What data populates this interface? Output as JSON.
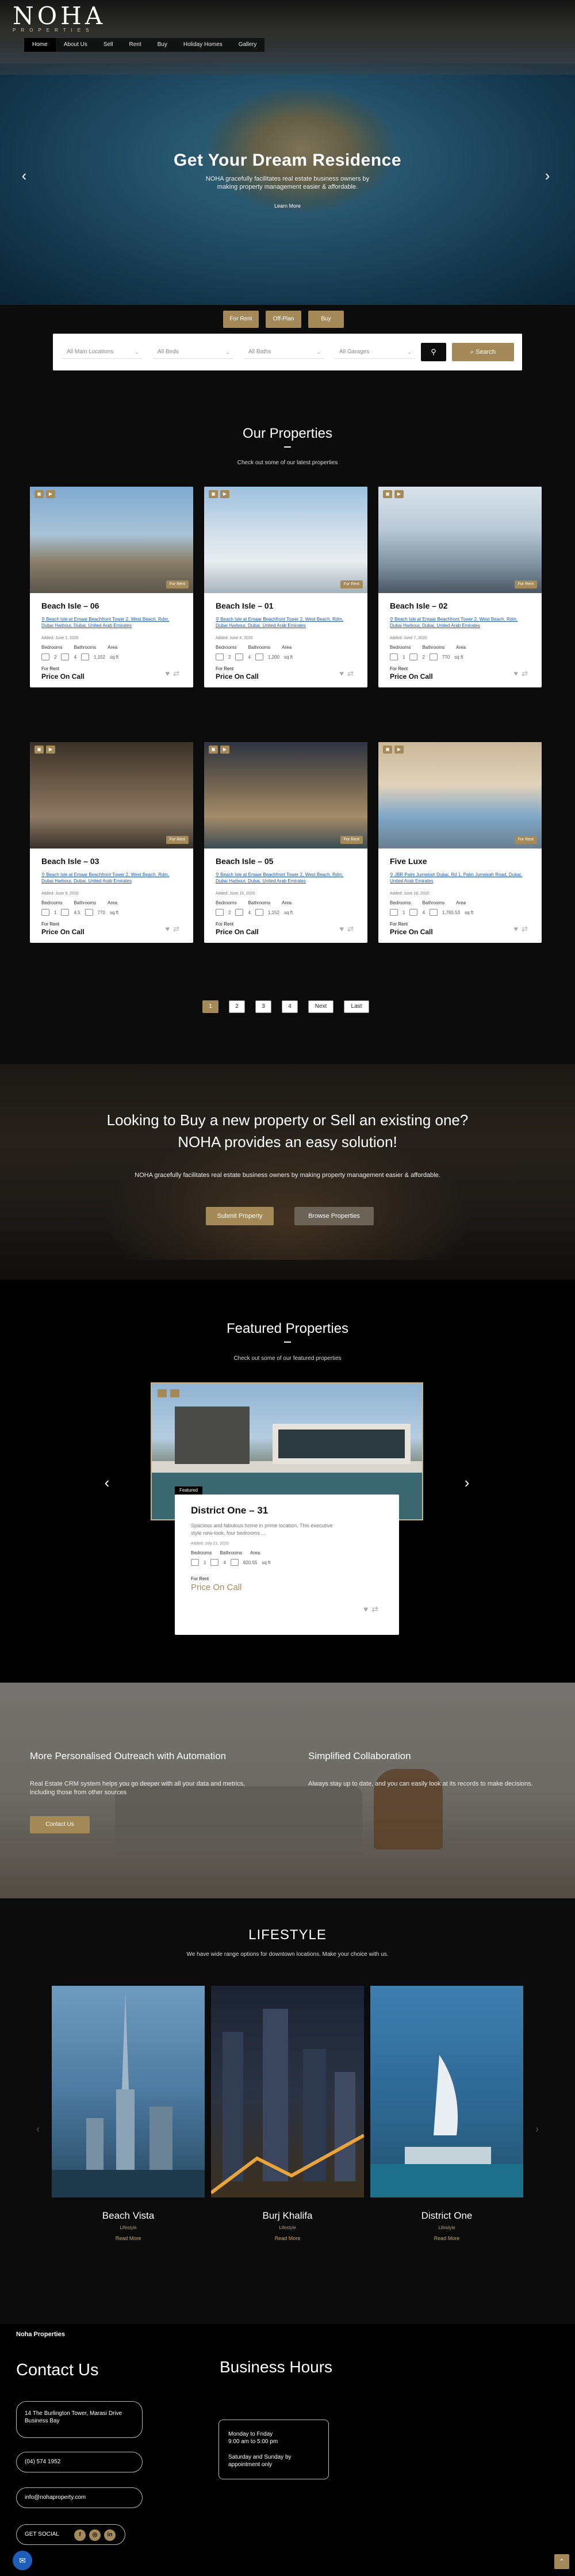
{
  "brand": {
    "logo": "NOHA",
    "tagline": "PROPERTIES"
  },
  "nav": [
    "Home",
    "About Us",
    "Sell",
    "Rent",
    "Buy",
    "Holiday Homes",
    "Gallery"
  ],
  "hero": {
    "title": "Get Your Dream Residence",
    "subtitle": "NOHA gracefully facilitates real estate business owners by making property management easier & affordable.",
    "button": "Learn More"
  },
  "search": {
    "tabs": [
      "For Rent",
      "Off-Plan",
      "Buy"
    ],
    "fields": [
      "All Main Locations",
      "All Beds",
      "All Baths",
      "All Garages"
    ],
    "button": "Search"
  },
  "properties": {
    "title": "Our Properties",
    "subtitle": "Check out some of our latest properties",
    "labels": {
      "bedrooms": "Bedrooms",
      "bathrooms": "Bathrooms",
      "area": "Area",
      "unit": "sq ft",
      "status": "For Rent",
      "price": "Price On Call"
    },
    "items": [
      {
        "title": "Beach Isle – 06",
        "address": "Beach Isle at Emaar Beachfront Tower 2, West Beach, Rdm, Dubai Harbour, Dubai, United Arab Emirates",
        "added": "Added: June 1, 2020",
        "beds": "2",
        "baths": "4",
        "area": "1,152",
        "badge": "For Rent"
      },
      {
        "title": "Beach Isle – 01",
        "address": "Beach Isle at Emaar Beachfront Tower 2, West Beach, Rdm, Dubai Harbour, Dubai, United Arab Emirates",
        "added": "Added: June 4, 2020",
        "beds": "2",
        "baths": "4",
        "area": "1,200",
        "badge": "For Rent"
      },
      {
        "title": "Beach Isle – 02",
        "address": "Beach Isle at Emaar Beachfront Tower 2, West Beach, Rdm, Dubai Harbour, Dubai, United Arab Emirates",
        "added": "Added: June 7, 2020",
        "beds": "1",
        "baths": "2",
        "area": "770",
        "badge": "For Rent"
      },
      {
        "title": "Beach Isle – 03",
        "address": "Beach Isle at Emaar Beachfront Tower 2, West Beach, Rdm, Dubai Harbour, Dubai, United Arab Emirates",
        "added": "Added: June 9, 2020",
        "beds": "1",
        "baths": "4.5",
        "area": "770",
        "badge": "For Rent"
      },
      {
        "title": "Beach Isle – 05",
        "address": "Beach Isle at Emaar Beachfront Tower 2, West Beach, Rdm, Dubai Harbour, Dubai, United Arab Emirates",
        "added": "Added: June 15, 2020",
        "beds": "2",
        "baths": "4",
        "area": "1,152",
        "badge": "For Rent"
      },
      {
        "title": "Five Luxe",
        "address": "JBR Palm Jumeirah Dubai, Rd 1, Palm Jumeirah Road, Dubai, United Arab Emirates",
        "added": "Added: June 18, 2020",
        "beds": "1",
        "baths": "4",
        "area": "1,765.53",
        "badge": "For Rent"
      }
    ],
    "pagination": [
      "1",
      "2",
      "3",
      "4",
      "Next",
      "Last"
    ]
  },
  "cta": {
    "title": "Looking to Buy a new property or Sell an existing one? NOHA provides an easy solution!",
    "subtitle": "NOHA gracefully facilitates real estate business owners by making property management easier & affordable.",
    "buttons": [
      "Submit Property",
      "Browse Properties"
    ]
  },
  "featured": {
    "title": "Featured Properties",
    "subtitle": "Check out some of our featured properties",
    "badge": "Featured",
    "item": {
      "title": "District One – 31",
      "description": "Spacious and fabulous home in prime location. This executive style new-look, four bedrooms ...",
      "added": "Added: July 21, 2020",
      "labels": [
        "Bedrooms",
        "Bathrooms",
        "Area"
      ],
      "beds": "1",
      "baths": "4",
      "area": "820.55",
      "unit": "sq ft",
      "status": "For Rent",
      "price": "Price On Call"
    }
  },
  "outreach": {
    "left_title": "More Personalised Outreach with Automation",
    "left_text": "Real Estate CRM system helps you go deeper with all your data and metrics, including those from other sources",
    "button": "Contact Us",
    "right_title": "Simplified Collaboration",
    "right_text": "Always stay up to date, and you can easily look at its records to make decisions."
  },
  "lifestyle": {
    "title": "LIFESTYLE",
    "subtitle": "We have wide range options for downtown locations. Make your choice with us.",
    "items": [
      {
        "name": "Beach Vista",
        "category": "Lifestyle",
        "link": "Read More"
      },
      {
        "name": "Burj Khalifa",
        "category": "Lifestyle",
        "link": "Read More"
      },
      {
        "name": "District One",
        "category": "Lifestyle",
        "link": "Read More"
      }
    ]
  },
  "footer": {
    "brand": "Noha Properties",
    "contact_title": "Contact Us",
    "address": "14 The Burlington Tower, Marasi Drive\nBusiness Bay",
    "phone": "(04) 574 1952",
    "email": "info@nohaproperty.com",
    "social_label": "GET SOCIAL",
    "hours_title": "Business Hours",
    "weekdays": "Monday to Friday\n9:00 am to 5:00 pm",
    "weekend": "Saturday and Sunday by appointment only"
  },
  "colors": {
    "accent": "#a48a58",
    "dark": "#0b0b0b",
    "link": "#1c58a6"
  }
}
